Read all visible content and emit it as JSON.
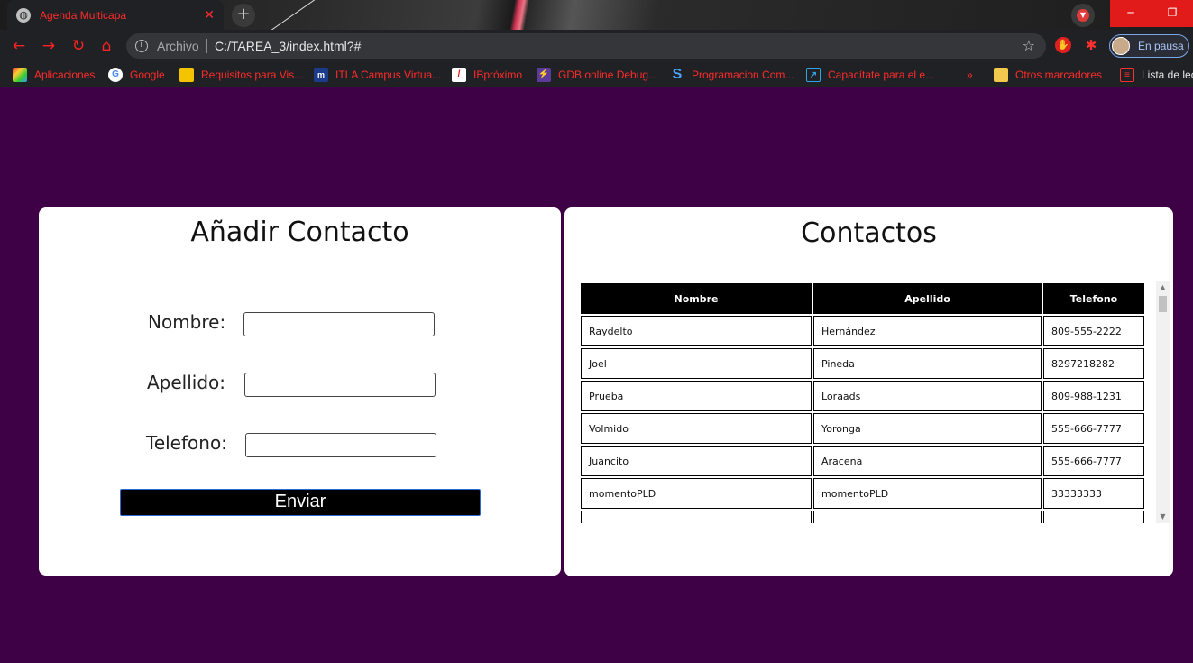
{
  "browser": {
    "tab_title": "Agenda Multicapa",
    "tab_close": "✕",
    "new_tab": "+",
    "url_scheme_label": "Archivo",
    "url": "C:/TAREA_3/index.html?#",
    "profile_status": "En pausa",
    "window_minimize": "─",
    "window_restore": "❐",
    "accent_color": "#ff2b2b"
  },
  "bookmarks": [
    {
      "label": "Aplicaciones",
      "icon": "apps-grid-icon"
    },
    {
      "label": "Google",
      "icon": "google-icon"
    },
    {
      "label": "Requisitos para Vis...",
      "icon": "bookmark-yellow-icon"
    },
    {
      "label": "ITLA Campus Virtua...",
      "icon": "itla-icon"
    },
    {
      "label": "IBpróximo",
      "icon": "ib-icon"
    },
    {
      "label": "GDB online Debug...",
      "icon": "gdb-icon"
    },
    {
      "label": "Programacion Com...",
      "icon": "s-icon"
    },
    {
      "label": "Capacítate para el e...",
      "icon": "capacitate-icon"
    }
  ],
  "bookmarks_overflow": "»",
  "other_bookmarks": "Otros marcadores",
  "reading_list": "Lista de lec",
  "form": {
    "title": "Añadir Contacto",
    "fields": [
      {
        "label": "Nombre:",
        "value": ""
      },
      {
        "label": "Apellido:",
        "value": ""
      },
      {
        "label": "Telefono:",
        "value": ""
      }
    ],
    "submit_label": "Enviar"
  },
  "contacts": {
    "title": "Contactos",
    "columns": [
      "Nombre",
      "Apellido",
      "Telefono"
    ],
    "rows": [
      [
        "Raydelto",
        "Hernández",
        "809-555-2222"
      ],
      [
        "Joel",
        "Pineda",
        "8297218282"
      ],
      [
        "Prueba",
        "Loraads",
        "809-988-1231"
      ],
      [
        "Volmido",
        "Yoronga",
        "555-666-7777"
      ],
      [
        "Juancito",
        "Aracena",
        "555-666-7777"
      ],
      [
        "momentoPLD",
        "momentoPLD",
        "33333333"
      ],
      [
        "",
        "",
        ""
      ]
    ]
  },
  "page_background": "#3f0146"
}
